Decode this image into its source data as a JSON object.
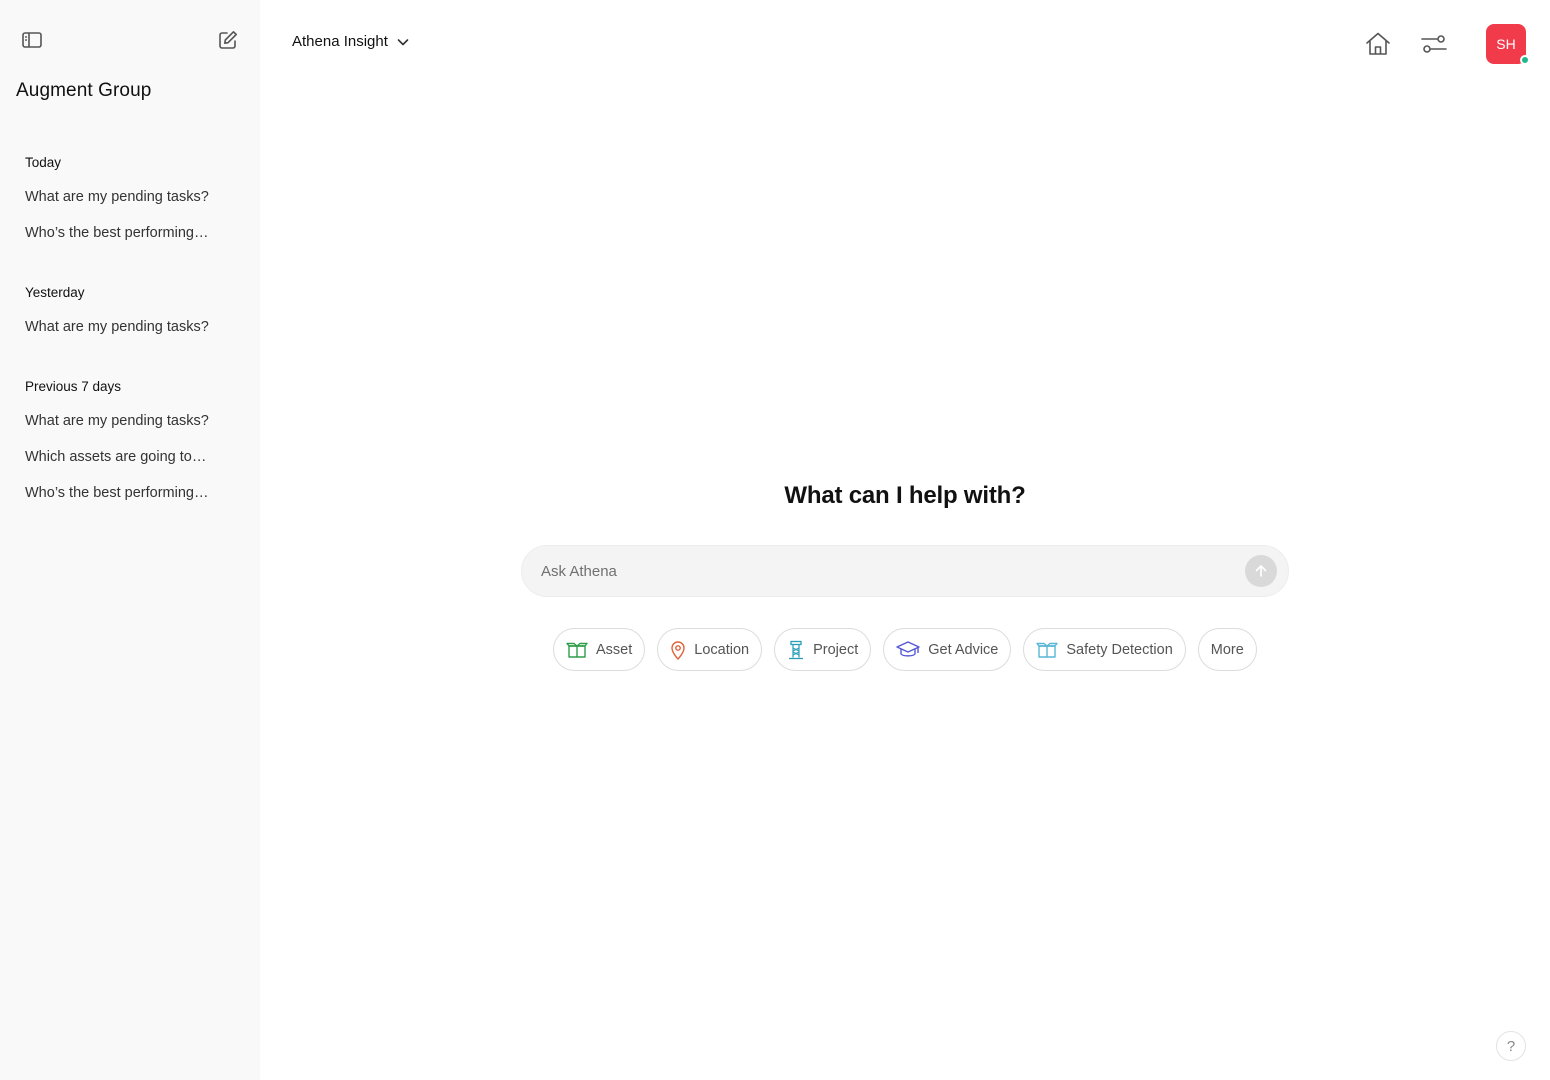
{
  "sidebar": {
    "org_name": "Augment Group",
    "groups": [
      {
        "title": "Today",
        "items": [
          "What are my pending tasks?",
          "Who’s the best performing…"
        ]
      },
      {
        "title": "Yesterday",
        "items": [
          "What are my pending tasks?"
        ]
      },
      {
        "title": "Previous 7 days",
        "items": [
          "What are my pending tasks?",
          "Which assets are going to…",
          "Who’s the best performing…"
        ]
      }
    ]
  },
  "header": {
    "model_name": "Athena Insight",
    "avatar_initials": "SH"
  },
  "main": {
    "title": "What can I help with?",
    "prompt_placeholder": "Ask Athena",
    "chips": [
      {
        "label": "Asset",
        "icon": "asset-box-icon",
        "color": "#2e9e4a"
      },
      {
        "label": "Location",
        "icon": "location-pin-icon",
        "color": "#e0603a"
      },
      {
        "label": "Project",
        "icon": "project-tower-icon",
        "color": "#2a9db8"
      },
      {
        "label": "Get Advice",
        "icon": "graduation-cap-icon",
        "color": "#5457d6"
      },
      {
        "label": "Safety Detection",
        "icon": "safety-box-icon",
        "color": "#58b6d6"
      },
      {
        "label": "More"
      }
    ]
  },
  "help": {
    "label": "?"
  },
  "colors": {
    "sidebar_bg": "#f9f9f9",
    "avatar_bg": "#f23b4a",
    "status_online": "#1fb88a",
    "prompt_bg": "#f4f4f4"
  }
}
